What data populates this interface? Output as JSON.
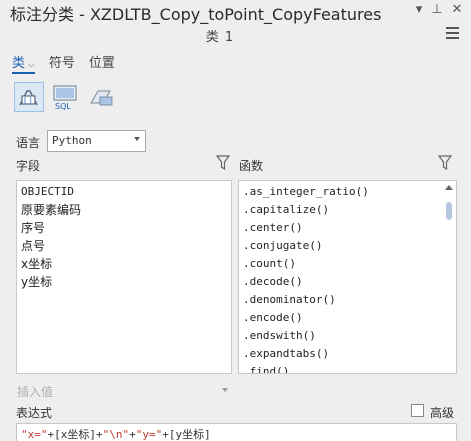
{
  "window": {
    "title": "标注分类 - XZDLTB_Copy_toPoint_CopyFeatures",
    "subtitle": "类 1",
    "controls": {
      "dropdown": "▾",
      "pin": "⊥",
      "close": "✕"
    }
  },
  "tabs": [
    {
      "label": "类",
      "active": true
    },
    {
      "label": "符号",
      "active": false
    },
    {
      "label": "位置",
      "active": false
    }
  ],
  "toolbar": [
    {
      "icon": "label-expression-icon",
      "active": true
    },
    {
      "icon": "sql-query-icon",
      "label": "SQL",
      "active": false
    },
    {
      "icon": "scale-range-icon",
      "active": false
    }
  ],
  "language": {
    "label": "语言",
    "value": "Python"
  },
  "fields": {
    "label": "字段",
    "items": [
      "OBJECTID",
      "原要素编码",
      "序号",
      "点号",
      "x坐标",
      "y坐标"
    ]
  },
  "functions": {
    "label": "函数",
    "items": [
      ".as_integer_ratio()",
      ".capitalize()",
      ".center()",
      ".conjugate()",
      ".count()",
      ".decode()",
      ".denominator()",
      ".encode()",
      ".endswith()",
      ".expandtabs()",
      ".find()"
    ]
  },
  "insert_values": {
    "label": "插入值"
  },
  "expression": {
    "label": "表达式",
    "advanced_label": "高级",
    "advanced_checked": false,
    "tokens": [
      "\"x=\"",
      "+",
      "[x坐标]",
      "+",
      "\"\\n\"",
      "+",
      "\"y=\"",
      "+",
      "[y坐标]"
    ]
  },
  "colors": {
    "accent": "#1a5fb4",
    "string": "#c0392b"
  }
}
